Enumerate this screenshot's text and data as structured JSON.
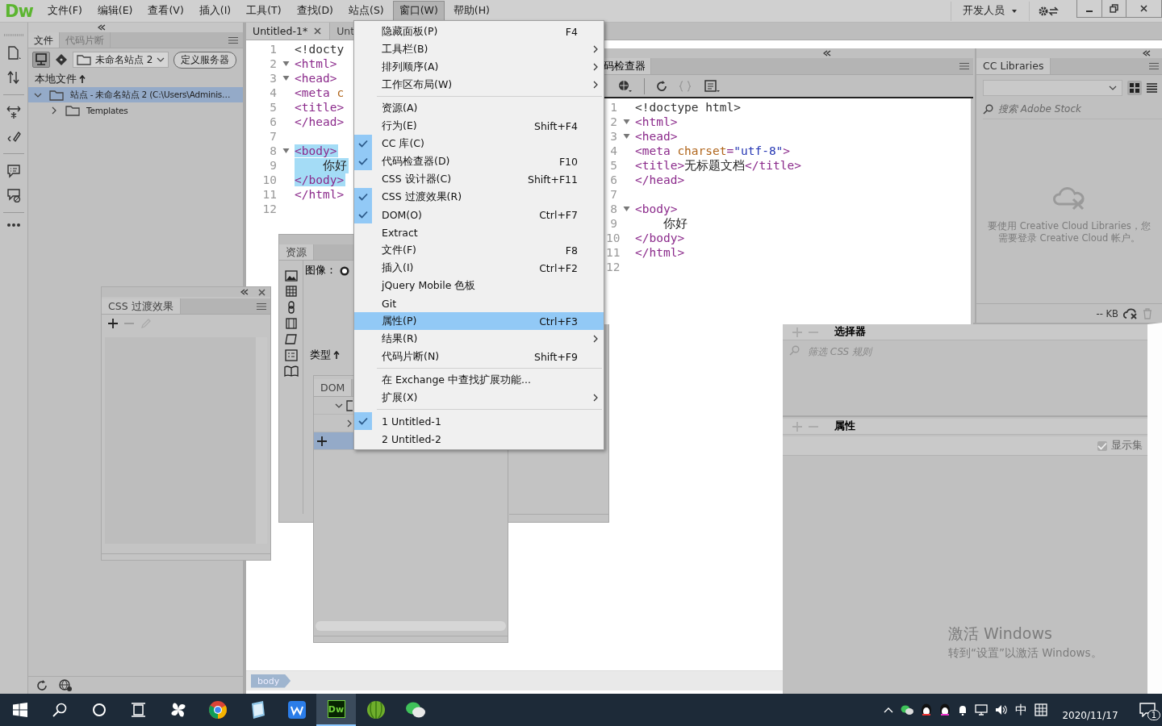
{
  "app": {
    "logo": "Dw",
    "menus": [
      {
        "label": "文件(F)",
        "selected": false
      },
      {
        "label": "编辑(E)",
        "selected": false
      },
      {
        "label": "查看(V)",
        "selected": false
      },
      {
        "label": "插入(I)",
        "selected": false
      },
      {
        "label": "工具(T)",
        "selected": false
      },
      {
        "label": "查找(D)",
        "selected": false
      },
      {
        "label": "站点(S)",
        "selected": false
      },
      {
        "label": "窗口(W)",
        "selected": true
      },
      {
        "label": "帮助(H)",
        "selected": false
      }
    ],
    "workspace": "开发人员"
  },
  "files_panel": {
    "tabs": [
      {
        "label": "文件",
        "selected": true
      },
      {
        "label": "代码片断",
        "selected": false
      }
    ],
    "site_select": "未命名站点 2",
    "define_server": "定义服务器",
    "column": "本地文件",
    "tree": [
      {
        "label": "站点 - 未命名站点 2 (C:\\Users\\Adminis…",
        "expanded": true,
        "selected": true,
        "children": [
          {
            "label": "Templates",
            "expanded": false,
            "selected": false
          }
        ]
      }
    ]
  },
  "document": {
    "tabs": [
      {
        "label": "Untitled-1*",
        "selected": true
      },
      {
        "label": "Unt",
        "selected": false
      }
    ],
    "lines": [
      {
        "number": "1",
        "fold": false,
        "highlighted": false,
        "tokens": [
          {
            "kind": "doctype",
            "text": "<!docty"
          }
        ]
      },
      {
        "number": "2",
        "fold": true,
        "highlighted": false,
        "tokens": [
          {
            "kind": "tag",
            "text": "<html>"
          }
        ]
      },
      {
        "number": "3",
        "fold": true,
        "highlighted": false,
        "tokens": [
          {
            "kind": "tag",
            "text": "<head>"
          }
        ]
      },
      {
        "number": "4",
        "fold": false,
        "highlighted": false,
        "tokens": [
          {
            "kind": "tag",
            "text": "<meta "
          },
          {
            "kind": "attr",
            "text": "c"
          }
        ]
      },
      {
        "number": "5",
        "fold": false,
        "highlighted": false,
        "tokens": [
          {
            "kind": "tag",
            "text": "<title>"
          }
        ]
      },
      {
        "number": "6",
        "fold": false,
        "highlighted": false,
        "tokens": [
          {
            "kind": "tag",
            "text": "</head>"
          }
        ]
      },
      {
        "number": "7",
        "fold": false,
        "highlighted": false
      },
      {
        "number": "8",
        "fold": true,
        "highlighted": true,
        "tokens": [
          {
            "kind": "tag",
            "text": "<body>"
          }
        ]
      },
      {
        "number": "9",
        "fold": false,
        "highlighted": true,
        "tokens": [
          {
            "kind": "text",
            "text": "    你好"
          }
        ]
      },
      {
        "number": "10",
        "fold": false,
        "highlighted": true,
        "tokens": [
          {
            "kind": "tag",
            "text": "</body>"
          }
        ]
      },
      {
        "number": "11",
        "fold": false,
        "highlighted": false,
        "tokens": [
          {
            "kind": "tag",
            "text": "</html>"
          }
        ]
      },
      {
        "number": "12",
        "fold": false,
        "highlighted": false
      }
    ],
    "status_tag": "body"
  },
  "window_menu": [
    {
      "kind": "item",
      "label": "隐藏面板(P)",
      "shortcut": "F4",
      "checked": false,
      "selected": false,
      "submenu": false
    },
    {
      "kind": "item",
      "label": "工具栏(B)",
      "checked": false,
      "selected": false,
      "submenu": true
    },
    {
      "kind": "item",
      "label": "排列顺序(A)",
      "checked": false,
      "selected": false,
      "submenu": true
    },
    {
      "kind": "item",
      "label": "工作区布局(W)",
      "checked": false,
      "selected": false,
      "submenu": true
    },
    {
      "kind": "separator"
    },
    {
      "kind": "item",
      "label": "资源(A)",
      "checked": false,
      "selected": false,
      "submenu": false
    },
    {
      "kind": "item",
      "label": "行为(E)",
      "shortcut": "Shift+F4",
      "checked": false,
      "selected": false,
      "submenu": false
    },
    {
      "kind": "item",
      "label": "CC 库(C)",
      "checked": true,
      "selected": false,
      "submenu": false
    },
    {
      "kind": "item",
      "label": "代码检查器(D)",
      "shortcut": "F10",
      "checked": true,
      "selected": false,
      "submenu": false
    },
    {
      "kind": "item",
      "label": "CSS 设计器(C)",
      "shortcut": "Shift+F11",
      "checked": false,
      "selected": false,
      "submenu": false
    },
    {
      "kind": "item",
      "label": "CSS 过渡效果(R)",
      "checked": true,
      "selected": false,
      "submenu": false
    },
    {
      "kind": "item",
      "label": "DOM(O)",
      "shortcut": "Ctrl+F7",
      "checked": true,
      "selected": false,
      "submenu": false
    },
    {
      "kind": "item",
      "label": "Extract",
      "checked": false,
      "selected": false,
      "submenu": false
    },
    {
      "kind": "item",
      "label": "文件(F)",
      "shortcut": "F8",
      "checked": false,
      "selected": false,
      "submenu": false
    },
    {
      "kind": "item",
      "label": "插入(I)",
      "shortcut": "Ctrl+F2",
      "checked": false,
      "selected": false,
      "submenu": false
    },
    {
      "kind": "item",
      "label": "jQuery Mobile 色板",
      "checked": false,
      "selected": false,
      "submenu": false
    },
    {
      "kind": "item",
      "label": "Git",
      "checked": false,
      "selected": false,
      "submenu": false
    },
    {
      "kind": "item",
      "label": "属性(P)",
      "shortcut": "Ctrl+F3",
      "checked": false,
      "selected": true,
      "submenu": false
    },
    {
      "kind": "item",
      "label": "结果(R)",
      "checked": false,
      "selected": false,
      "submenu": true
    },
    {
      "kind": "item",
      "label": "代码片断(N)",
      "shortcut": "Shift+F9",
      "checked": false,
      "selected": false,
      "submenu": false
    },
    {
      "kind": "separator"
    },
    {
      "kind": "item",
      "label": "在 Exchange 中查找扩展功能...",
      "checked": false,
      "selected": false,
      "submenu": false
    },
    {
      "kind": "item",
      "label": "扩展(X)",
      "checked": false,
      "selected": false,
      "submenu": true
    },
    {
      "kind": "separator"
    },
    {
      "kind": "item",
      "label": "1 Untitled-1",
      "checked": true,
      "selected": false,
      "submenu": false
    },
    {
      "kind": "item",
      "label": "2 Untitled-2",
      "checked": false,
      "selected": false,
      "submenu": false
    }
  ],
  "code_inspector": {
    "tab": "码检查器",
    "lines": [
      {
        "number": "1",
        "fold": false,
        "highlighted": false,
        "tokens": [
          {
            "kind": "doctype",
            "text": "<!doctype html>"
          }
        ]
      },
      {
        "number": "2",
        "fold": true,
        "highlighted": false,
        "tokens": [
          {
            "kind": "tag",
            "text": "<html>"
          }
        ]
      },
      {
        "number": "3",
        "fold": true,
        "highlighted": false,
        "tokens": [
          {
            "kind": "tag",
            "text": "<head>"
          }
        ]
      },
      {
        "number": "4",
        "fold": false,
        "highlighted": false,
        "tokens": [
          {
            "kind": "tag",
            "text": "<meta "
          },
          {
            "kind": "attr",
            "text": "charset"
          },
          {
            "kind": "tag",
            "text": "="
          },
          {
            "kind": "value",
            "text": "\"utf-8\""
          },
          {
            "kind": "tag",
            "text": ">"
          }
        ]
      },
      {
        "number": "5",
        "fold": false,
        "highlighted": false,
        "tokens": [
          {
            "kind": "tag",
            "text": "<title>"
          },
          {
            "kind": "text",
            "text": "无标题文档"
          },
          {
            "kind": "tag",
            "text": "</title>"
          }
        ]
      },
      {
        "number": "6",
        "fold": false,
        "highlighted": false,
        "tokens": [
          {
            "kind": "tag",
            "text": "</head>"
          }
        ]
      },
      {
        "number": "7",
        "fold": false,
        "highlighted": false
      },
      {
        "number": "8",
        "fold": true,
        "highlighted": false,
        "tokens": [
          {
            "kind": "tag",
            "text": "<body>"
          }
        ]
      },
      {
        "number": "9",
        "fold": false,
        "highlighted": false,
        "tokens": [
          {
            "kind": "text",
            "text": "    你好"
          }
        ]
      },
      {
        "number": "10",
        "fold": false,
        "highlighted": false,
        "tokens": [
          {
            "kind": "tag",
            "text": "</body>"
          }
        ]
      },
      {
        "number": "11",
        "fold": false,
        "highlighted": false,
        "tokens": [
          {
            "kind": "tag",
            "text": "</html>"
          }
        ]
      },
      {
        "number": "12",
        "fold": false,
        "highlighted": false
      }
    ]
  },
  "cc_libraries": {
    "tab": "CC Libraries",
    "search_placeholder": "搜索 Adobe Stock",
    "message_lines": [
      "要使用 Creative Cloud Libraries，您",
      "需要登录 Creative Cloud 帐户。"
    ],
    "size": "-- KB"
  },
  "css_designer": {
    "selectors_heading": "选择器",
    "filter_placeholder": "筛选 CSS 规则",
    "properties_heading": "属性",
    "show_set": {
      "label": "显示集",
      "checked": true
    }
  },
  "transitions_panel": {
    "tab": "CSS 过渡效果"
  },
  "assets_panel": {
    "tab": "资源",
    "images_label": "图像：",
    "sort_column": "类型"
  },
  "dom_panel": {
    "tab": "DOM"
  },
  "activation": {
    "title": "激活 Windows",
    "subtitle": "转到“设置”以激活 Windows。"
  },
  "taskbar": {
    "apps": [
      {
        "kind": "start",
        "selected": false
      },
      {
        "kind": "search",
        "selected": false
      },
      {
        "kind": "cortana",
        "selected": false
      },
      {
        "kind": "taskview",
        "selected": false
      },
      {
        "kind": "pinwheel",
        "selected": false
      },
      {
        "kind": "chrome",
        "selected": false
      },
      {
        "kind": "notebook",
        "selected": false
      },
      {
        "kind": "wps",
        "selected": false
      },
      {
        "kind": "dw",
        "label": "Dw",
        "selected": true
      },
      {
        "kind": "ball",
        "selected": false
      },
      {
        "kind": "wechat",
        "selected": false
      }
    ],
    "ime": "中",
    "date": "2020/11/17",
    "notifications": "1"
  }
}
